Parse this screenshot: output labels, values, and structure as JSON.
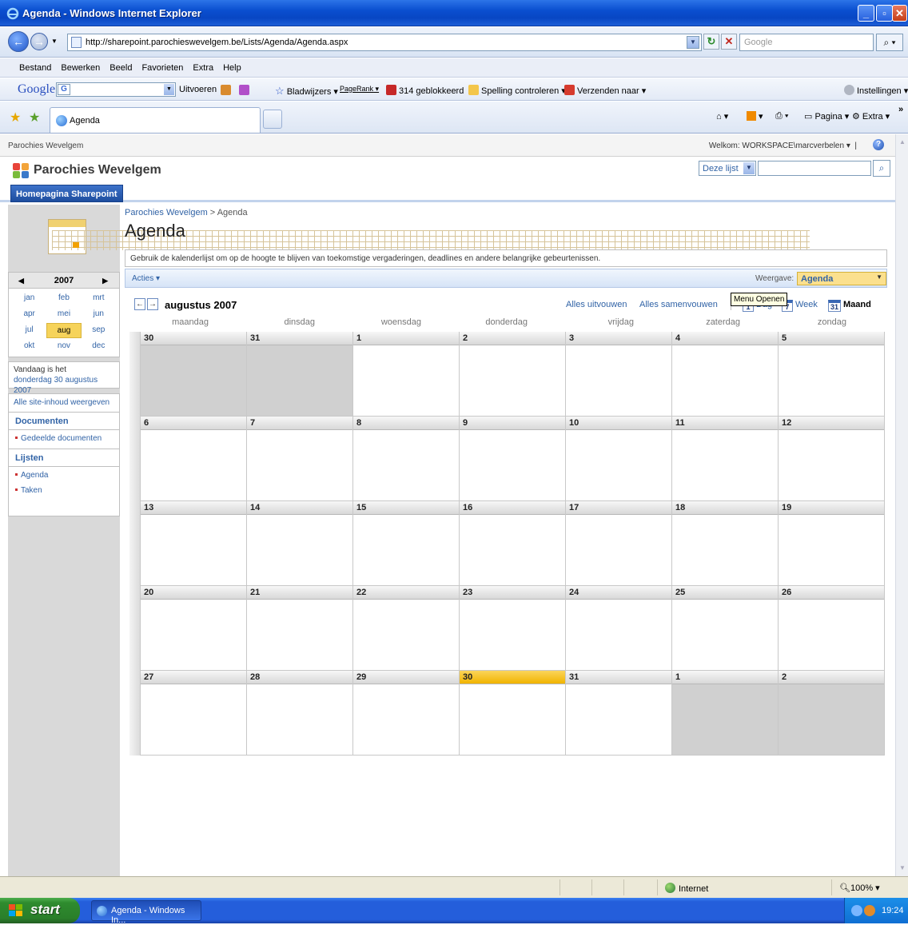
{
  "window": {
    "title": "Agenda - Windows Internet Explorer"
  },
  "address": {
    "url": "http://sharepoint.parochieswevelgem.be/Lists/Agenda/Agenda.aspx",
    "search_placeholder": "Google"
  },
  "menu": [
    "Bestand",
    "Bewerken",
    "Beeld",
    "Favorieten",
    "Extra",
    "Help"
  ],
  "google_toolbar": {
    "logo": "Google",
    "uitvoeren": "Uitvoeren",
    "bladwijzers": "Bladwijzers",
    "pagerank": "PageRank",
    "blocked": "314 geblokkeerd",
    "spelling": "Spelling controleren",
    "verzenden": "Verzenden naar",
    "instellingen": "Instellingen"
  },
  "tab": {
    "label": "Agenda"
  },
  "commandbar": {
    "pagina": "Pagina",
    "extra": "Extra"
  },
  "sharepoint": {
    "site_name": "Parochies Wevelgem",
    "welcome": "Welkom: WORKSPACE\\marcverbelen",
    "scope": "Deze lijst",
    "site_title": "Parochies Wevelgem",
    "home_tab": "Homepagina Sharepoint",
    "breadcrumb": {
      "site": "Parochies Wevelgem",
      "sep": ">",
      "current": "Agenda"
    },
    "page_title": "Agenda",
    "description": "Gebruik de kalenderlijst om op de hoogte te blijven van toekomstige vergaderingen, deadlines en andere belangrijke gebeurtenissen.",
    "actions_label": "Acties",
    "view_label": "Weergave:",
    "view_value": "Agenda",
    "tooltip": "Menu Openen"
  },
  "datepicker": {
    "year": "2007",
    "months": [
      "jan",
      "feb",
      "mrt",
      "apr",
      "mei",
      "jun",
      "jul",
      "aug",
      "sep",
      "okt",
      "nov",
      "dec"
    ],
    "selected": "aug"
  },
  "today": {
    "line1": "Vandaag is het",
    "line2": "donderdag 30 augustus 2007"
  },
  "quicklaunch": {
    "all": "Alle site-inhoud weergeven",
    "docs_header": "Documenten",
    "docs": [
      "Gedeelde documenten"
    ],
    "lists_header": "Lijsten",
    "lists": [
      "Agenda",
      "Taken"
    ]
  },
  "calendar": {
    "month_title": "augustus 2007",
    "expand_all": "Alles uitvouwen",
    "collapse_all": "Alles samenvouwen",
    "view_day": "Dag",
    "view_week": "Week",
    "view_month": "Maand",
    "day_icon": "1",
    "week_icon": "7",
    "month_icon": "31",
    "days": [
      "maandag",
      "dinsdag",
      "woensdag",
      "donderdag",
      "vrijdag",
      "zaterdag",
      "zondag"
    ],
    "weeks": [
      [
        {
          "n": "30",
          "other": true
        },
        {
          "n": "31",
          "other": true
        },
        {
          "n": "1"
        },
        {
          "n": "2"
        },
        {
          "n": "3"
        },
        {
          "n": "4"
        },
        {
          "n": "5"
        }
      ],
      [
        {
          "n": "6"
        },
        {
          "n": "7"
        },
        {
          "n": "8"
        },
        {
          "n": "9"
        },
        {
          "n": "10"
        },
        {
          "n": "11"
        },
        {
          "n": "12"
        }
      ],
      [
        {
          "n": "13"
        },
        {
          "n": "14"
        },
        {
          "n": "15"
        },
        {
          "n": "16"
        },
        {
          "n": "17"
        },
        {
          "n": "18"
        },
        {
          "n": "19"
        }
      ],
      [
        {
          "n": "20"
        },
        {
          "n": "21"
        },
        {
          "n": "22"
        },
        {
          "n": "23"
        },
        {
          "n": "24"
        },
        {
          "n": "25"
        },
        {
          "n": "26"
        }
      ],
      [
        {
          "n": "27"
        },
        {
          "n": "28"
        },
        {
          "n": "29"
        },
        {
          "n": "30",
          "today": true
        },
        {
          "n": "31"
        },
        {
          "n": "1",
          "other": true
        },
        {
          "n": "2",
          "other": true
        }
      ]
    ]
  },
  "status": {
    "zone": "Internet",
    "zoom": "100%"
  },
  "taskbar": {
    "start": "start",
    "item": "Agenda - Windows In...",
    "clock": "19:24"
  }
}
